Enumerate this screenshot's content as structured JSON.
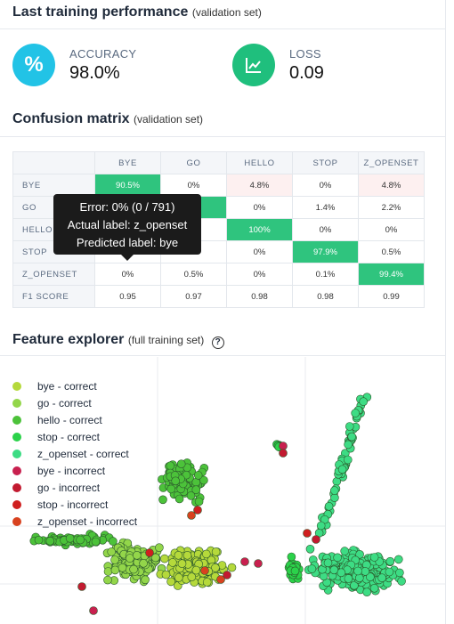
{
  "performance": {
    "title": "Last training performance",
    "subtitle": "(validation set)",
    "accuracy": {
      "label": "ACCURACY",
      "value": "98.0%",
      "icon": "percent-icon",
      "color": "#22c3e6"
    },
    "loss": {
      "label": "LOSS",
      "value": "0.09",
      "icon": "chart-trend-icon",
      "color": "#1fbf7d"
    }
  },
  "confusion": {
    "title": "Confusion matrix",
    "subtitle": "(validation set)",
    "columns": [
      "BYE",
      "GO",
      "HELLO",
      "STOP",
      "Z_OPENSET"
    ],
    "rows": [
      {
        "label": "BYE",
        "cells": [
          "90.5%",
          "0%",
          "4.8%",
          "0%",
          "4.8%"
        ]
      },
      {
        "label": "GO",
        "cells": [
          "",
          "",
          "0%",
          "1.4%",
          "2.2%"
        ]
      },
      {
        "label": "HELLO",
        "cells": [
          "",
          "",
          "100%",
          "0%",
          "0%"
        ]
      },
      {
        "label": "STOP",
        "cells": [
          "",
          "",
          "0%",
          "97.9%",
          "0.5%"
        ]
      },
      {
        "label": "Z_OPENSET",
        "cells": [
          "0%",
          "0.5%",
          "0%",
          "0.1%",
          "99.4%"
        ]
      }
    ],
    "f1": {
      "label": "F1 SCORE",
      "cells": [
        "0.95",
        "0.97",
        "0.98",
        "0.98",
        "0.99"
      ]
    },
    "highlight_color": "#2fc47e",
    "error_tint": "#fdf0f0",
    "tooltip": {
      "line1": "Error: 0% (0 / 791)",
      "line2": "Actual label: z_openset",
      "line3": "Predicted label: bye"
    }
  },
  "explorer": {
    "title": "Feature explorer",
    "subtitle": "(full training set)",
    "legend": [
      {
        "label": "bye - correct",
        "color": "#b5d93b"
      },
      {
        "label": "go - correct",
        "color": "#93d64a"
      },
      {
        "label": "hello - correct",
        "color": "#4cc23a"
      },
      {
        "label": "stop - correct",
        "color": "#2bd24a"
      },
      {
        "label": "z_openset - correct",
        "color": "#3ddc84"
      },
      {
        "label": "bye - incorrect",
        "color": "#c8204f"
      },
      {
        "label": "go - incorrect",
        "color": "#c21a30"
      },
      {
        "label": "stop - incorrect",
        "color": "#cf1f1f"
      },
      {
        "label": "z_openset - incorrect",
        "color": "#d8421f"
      }
    ]
  }
}
